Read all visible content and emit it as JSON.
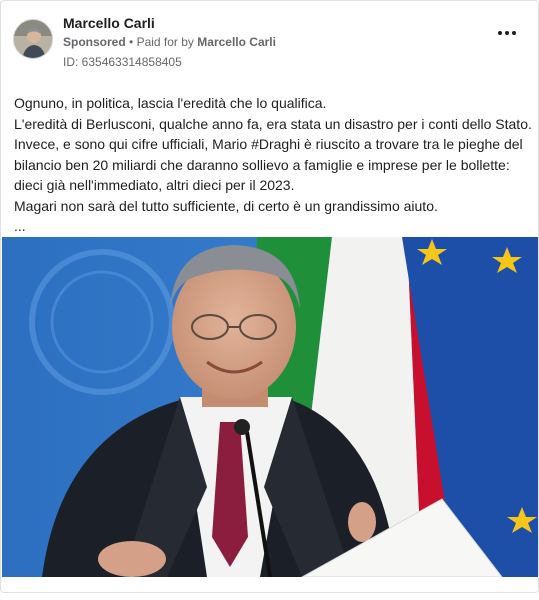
{
  "post": {
    "author_name": "Marcello Carli",
    "sponsored_label": "Sponsored",
    "separator": "•",
    "paid_for_prefix": "Paid for by",
    "paid_for_name": "Marcello Carli",
    "ad_id": "ID: 635463314858405",
    "more_icon": "more-horizontal-icon",
    "body_lines": [
      "Ognuno, in politica, lascia l'eredità che lo qualifica.",
      "L'eredità di Berlusconi, qualche anno fa, era stata un disastro per i conti dello Stato.",
      "Invece, e sono qui cifre ufficiali, Mario #Draghi è riuscito a trovare tra le pieghe del",
      "bilancio ben 20 miliardi che daranno sollievo a famiglie e imprese per le bollette:",
      "dieci già nell'immediato, altri dieci per il 2023.",
      "Magari non sarà del tutto sufficiente, di certo è un grandissimo aiuto.",
      "..."
    ]
  },
  "colors": {
    "text_primary": "#1c1e21",
    "text_secondary": "#65676b",
    "eu_blue": "#1d4fa8",
    "eu_star": "#f5c518",
    "italy_green": "#1f8f3a",
    "italy_red": "#c8102e",
    "backdrop_blue": "#2f78c8"
  }
}
